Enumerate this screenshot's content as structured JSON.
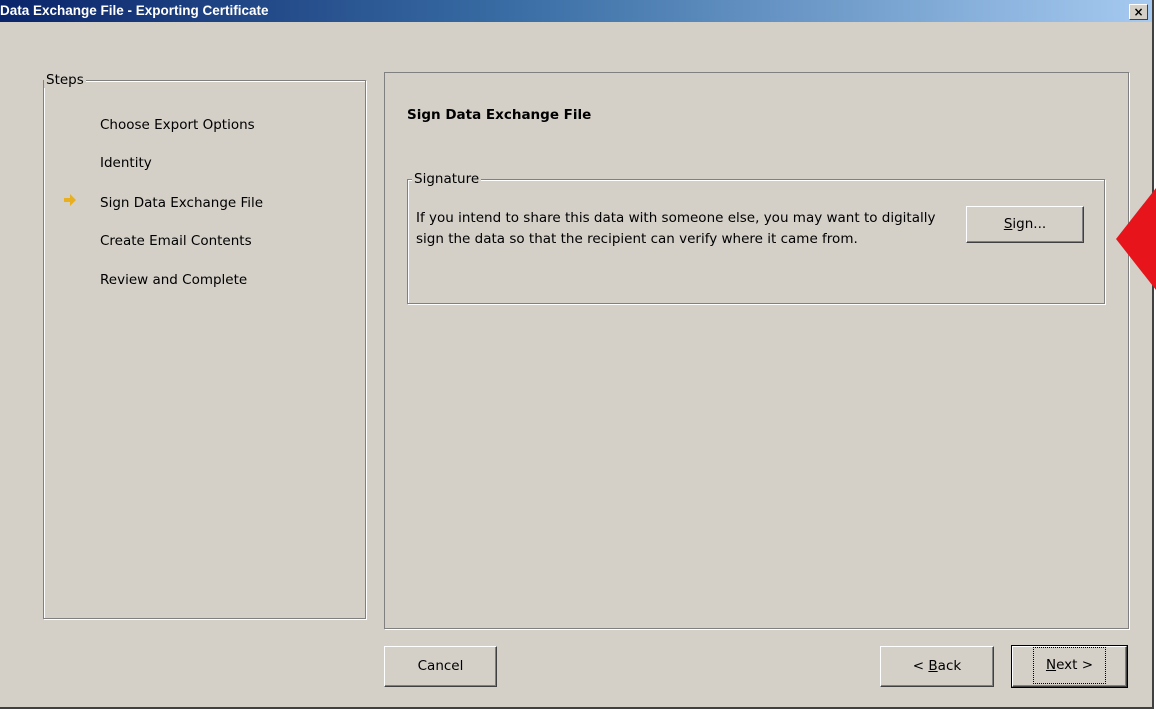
{
  "window": {
    "title": "Data Exchange File - Exporting Certificate",
    "close_label": "×"
  },
  "steps": {
    "legend": "Steps",
    "items": [
      {
        "label": "Choose Export Options",
        "current": false
      },
      {
        "label": "Identity",
        "current": false
      },
      {
        "label": "Sign Data Exchange File",
        "current": true
      },
      {
        "label": "Create Email Contents",
        "current": false
      },
      {
        "label": "Review and Complete",
        "current": false
      }
    ]
  },
  "main": {
    "heading": "Sign Data Exchange File",
    "signature": {
      "legend": "Signature",
      "description": "If you intend to share this data with someone else, you may want to digitally sign the data so that the recipient can verify where it came from.",
      "sign_button": {
        "mnemonic": "S",
        "rest": "ign..."
      }
    }
  },
  "buttons": {
    "cancel": "Cancel",
    "back": {
      "prefix": "< ",
      "mnemonic": "B",
      "rest": "ack"
    },
    "next": {
      "mnemonic": "N",
      "rest": "ext >"
    }
  },
  "colors": {
    "dialog_bg": "#d4d0c8",
    "titlebar_start": "#0a246a",
    "titlebar_end": "#a6caf0",
    "step_arrow": "#e8b020",
    "annotation_arrow": "#e8141b"
  }
}
